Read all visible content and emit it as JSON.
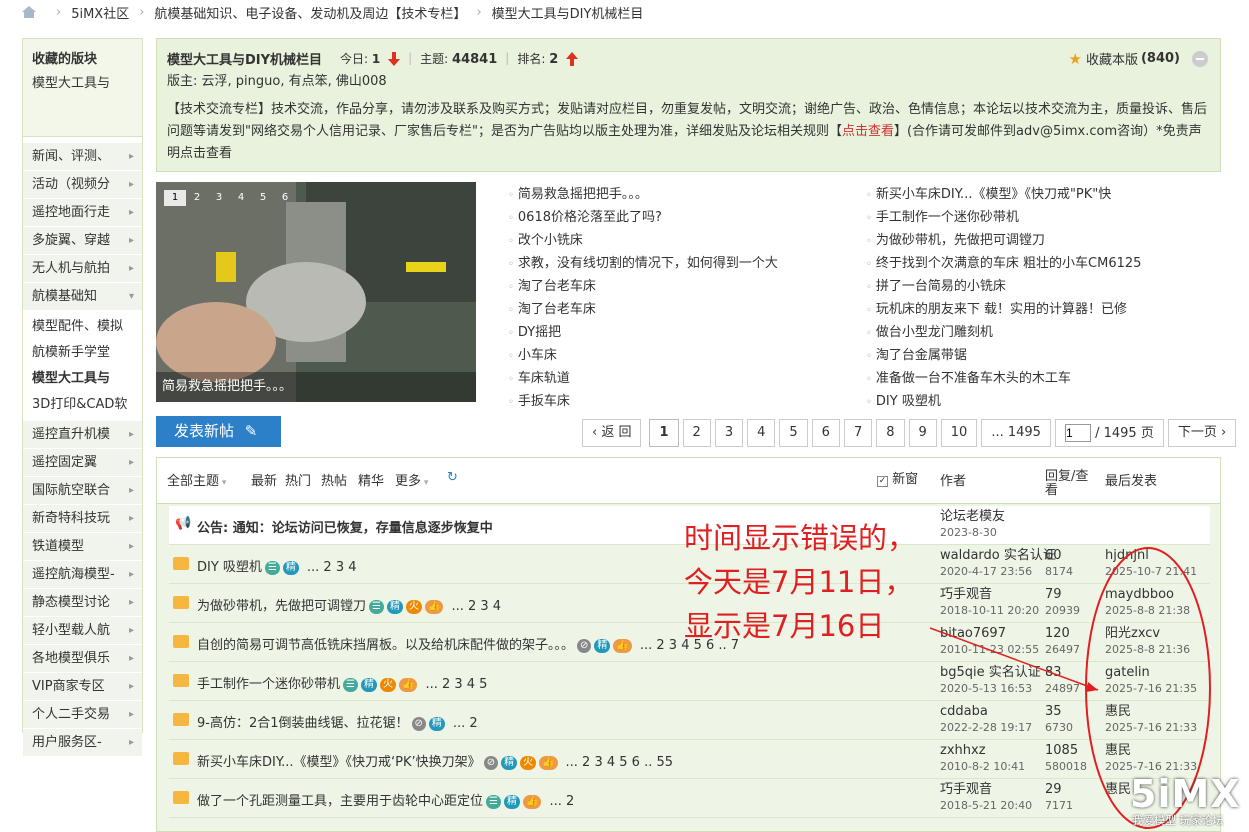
{
  "breadcrumb": [
    "5iMX社区",
    "航模基础知识、电子设备、发动机及周边【技术专栏】",
    "模型大工具与DIY机械栏目"
  ],
  "sidebar": {
    "fav_title": "收藏的版块",
    "fav_item": "模型大工具与",
    "items": [
      "新闻、评测、",
      "活动（视频分",
      "遥控地面行走",
      "多旋翼、穿越",
      "无人机与航拍",
      "航模基础知"
    ],
    "sub_items": [
      "模型配件、模拟",
      "航模新手学堂",
      "模型大工具与",
      "3D打印&CAD软"
    ],
    "items2": [
      "遥控直升机模",
      "遥控固定翼",
      "国际航空联合",
      "新奇特科技玩",
      "铁道模型",
      "遥控航海模型-",
      "静态模型讨论",
      "轻小型载人航",
      "各地模型俱乐",
      "VIP商家专区",
      "个人二手交易",
      "用户服务区-"
    ]
  },
  "forum": {
    "name": "模型大工具与DIY机械栏目",
    "today_label": "今日:",
    "today": "1",
    "topics_label": "主题:",
    "topics": "44841",
    "rank_label": "排名:",
    "rank": "2",
    "fav_label": "收藏本版",
    "fav_count": "(840)",
    "moderators": "版主: 云浮, pinguo, 有点笨, 佛山008",
    "desc": "【技术交流专栏】技术交流，作品分享，请勿涉及联系及购买方式；发贴请对应栏目，勿重复发帖，文明交流；谢绝广告、政治、色情信息；本论坛以技术交流为主，质量投诉、售后问题等请发到\"网络交易个人信用记录、厂家售后专栏\"；是否为广告贴均以版主处理为准，详细发贴及论坛相关规则【",
    "desc_link": "点击查看",
    "desc2": "】(合作请可发邮件到adv@5imx.com咨询）*免责声明",
    "desc_link2": "点击查看"
  },
  "slideshow": {
    "nums": [
      "1",
      "2",
      "3",
      "4",
      "5",
      "6"
    ],
    "caption": "简易救急摇把把手。。。"
  },
  "links_col1": [
    "简易救急摇把把手。。。",
    "0618价格沦落至此了吗?",
    "改个小铣床",
    "求教，没有线切割的情况下，如何得到一个大",
    "淘了台老车床",
    "淘了台老车床",
    "DY摇把",
    "小车床",
    "车床轨道",
    "手扳车床"
  ],
  "links_col2": [
    "新买小车床DIY...《模型》《快刀戒\"PK\"快",
    "手工制作一个迷你砂带机",
    "为做砂带机，先做把可调镗刀",
    "终于找到个次满意的车床 粗壮的小车CM6125",
    "拼了一台简易的小铣床",
    "玩机床的朋友来下 载！实用的计算器！已修",
    "做台小型龙门雕刻机",
    "淘了台金属带锯",
    "准备做一台不准备车木头的木工车",
    "DIY 吸塑机"
  ],
  "post_button": "发表新帖",
  "pager": {
    "back": "返 回",
    "pages": [
      "1",
      "2",
      "3",
      "4",
      "5",
      "6",
      "7",
      "8",
      "9",
      "10"
    ],
    "ellipsis": "... 1495",
    "input": "1",
    "total": "/ 1495 页",
    "next": "下一页"
  },
  "thread_header": {
    "all": "全部主题",
    "latest": "最新",
    "hot": "热门",
    "hotpost": "热帖",
    "digest": "精华",
    "more": "更多",
    "newwin": "新窗",
    "author": "作者",
    "reply": "回复/查看",
    "last": "最后发表"
  },
  "announce": {
    "label": "公告:",
    "text": "通知：论坛访问已恢复，存量信息逐步恢复中",
    "author": "论坛老模友",
    "date": "2023-8-30"
  },
  "threads": [
    {
      "title": "DIY 吸塑机",
      "pages": "... 2 3 4",
      "author": "waldardo 实名认证",
      "date": "2020-4-17 23:56",
      "replies": "60",
      "views": "8174",
      "last_user": "hjdnjnl",
      "last_date": "2025-10-7 21:41"
    },
    {
      "title": "为做砂带机，先做把可调镗刀",
      "pages": "... 2 3 4",
      "author": "巧手观音",
      "date": "2018-10-11 20:20",
      "replies": "79",
      "views": "20939",
      "last_user": "maydbboo",
      "last_date": "2025-8-8 21:38"
    },
    {
      "title": "自创的简易可调节高低铣床挡屑板。以及给机床配件做的架子。。。",
      "pages": "... 2 3 4 5 6 .. 7",
      "author": "bitao7697",
      "date": "2010-11-23 02:55",
      "replies": "120",
      "views": "26497",
      "last_user": "阳光zxcv",
      "last_date": "2025-8-8 21:36"
    },
    {
      "title": "手工制作一个迷你砂带机",
      "pages": "... 2 3 4 5",
      "author": "bg5qie 实名认证",
      "date": "2020-5-13 16:53",
      "replies": "83",
      "views": "24897",
      "last_user": "gatelin",
      "last_date": "2025-7-16 21:35"
    },
    {
      "title": "9-高仿：2合1倒装曲线锯、拉花锯！",
      "pages": "... 2",
      "author": "cddaba",
      "date": "2022-2-28 19:17",
      "replies": "35",
      "views": "6730",
      "last_user": "惠民",
      "last_date": "2025-7-16 21:33"
    },
    {
      "title": "新买小车床DIY...《模型》《快刀戒‘PK’快换刀架》",
      "pages": "... 2 3 4 5 6 .. 55",
      "author": "zxhhxz",
      "date": "2010-8-2 10:41",
      "replies": "1085",
      "views": "580018",
      "last_user": "惠民",
      "last_date": "2025-7-16 21:33"
    },
    {
      "title": "做了一个孔距测量工具，主要用于齿轮中心距定位",
      "pages": "... 2",
      "author": "巧手观音",
      "date": "2018-5-21 20:40",
      "replies": "29",
      "views": "7171",
      "last_user": "惠民",
      "last_date": ""
    }
  ],
  "annotation": [
    "时间显示错误的，",
    "今天是7月11日，",
    "显示是7月16日"
  ],
  "watermark": "5iMX",
  "watermark_sub": "我爱模型 玩家论坛",
  "colors": {
    "accent": "#2b80c7",
    "annot": "#e02020",
    "panel": "#e8f2dc"
  }
}
